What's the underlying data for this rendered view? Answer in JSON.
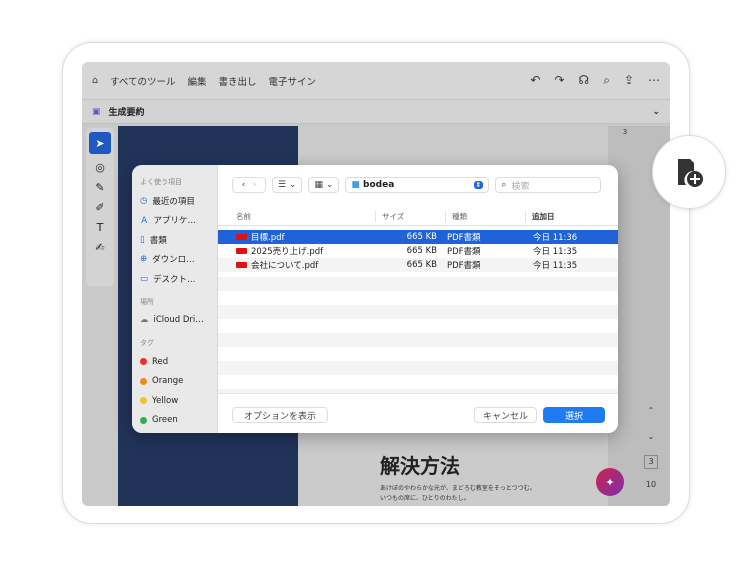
{
  "toolbar": {
    "items": [
      "すべてのツール",
      "編集",
      "書き出し",
      "電子サイン"
    ]
  },
  "subbar": {
    "title": "生成要約"
  },
  "document": {
    "heading": "解決方法",
    "body_lines": [
      "あけぼのやわらかな光が、まどろむ教室をそっとつつむ。",
      "いつもの席に、ひとりのわたし。"
    ],
    "page_badge": "3",
    "current_page": "3",
    "total_pages": "10"
  },
  "dialog": {
    "sidebar": {
      "favorites_header": "よく使う項目",
      "favorites": [
        "最近の項目",
        "アプリケ…",
        "書類",
        "ダウンロ…",
        "デスクト…"
      ],
      "locations_header": "場所",
      "locations": [
        "iCloud Dri…"
      ],
      "tags_header": "タグ",
      "tags": [
        {
          "label": "Red",
          "color": "#e8312a"
        },
        {
          "label": "Orange",
          "color": "#f08a1c"
        },
        {
          "label": "Yellow",
          "color": "#f2c12e"
        },
        {
          "label": "Green",
          "color": "#2bb24c"
        }
      ]
    },
    "location": "bodea",
    "search_placeholder": "検索",
    "columns": [
      "名前",
      "サイズ",
      "種類",
      "追加日"
    ],
    "files": [
      {
        "name": "目標.pdf",
        "size": "665 KB",
        "kind": "PDF書類",
        "added": "今日 11:36"
      },
      {
        "name": "2025売り上げ.pdf",
        "size": "665 KB",
        "kind": "PDF書類",
        "added": "今日 11:35"
      },
      {
        "name": "会社について.pdf",
        "size": "665 KB",
        "kind": "PDF書類",
        "added": "今日 11:35"
      }
    ],
    "options_button": "オプションを表示",
    "cancel_button": "キャンセル",
    "select_button": "選択"
  }
}
